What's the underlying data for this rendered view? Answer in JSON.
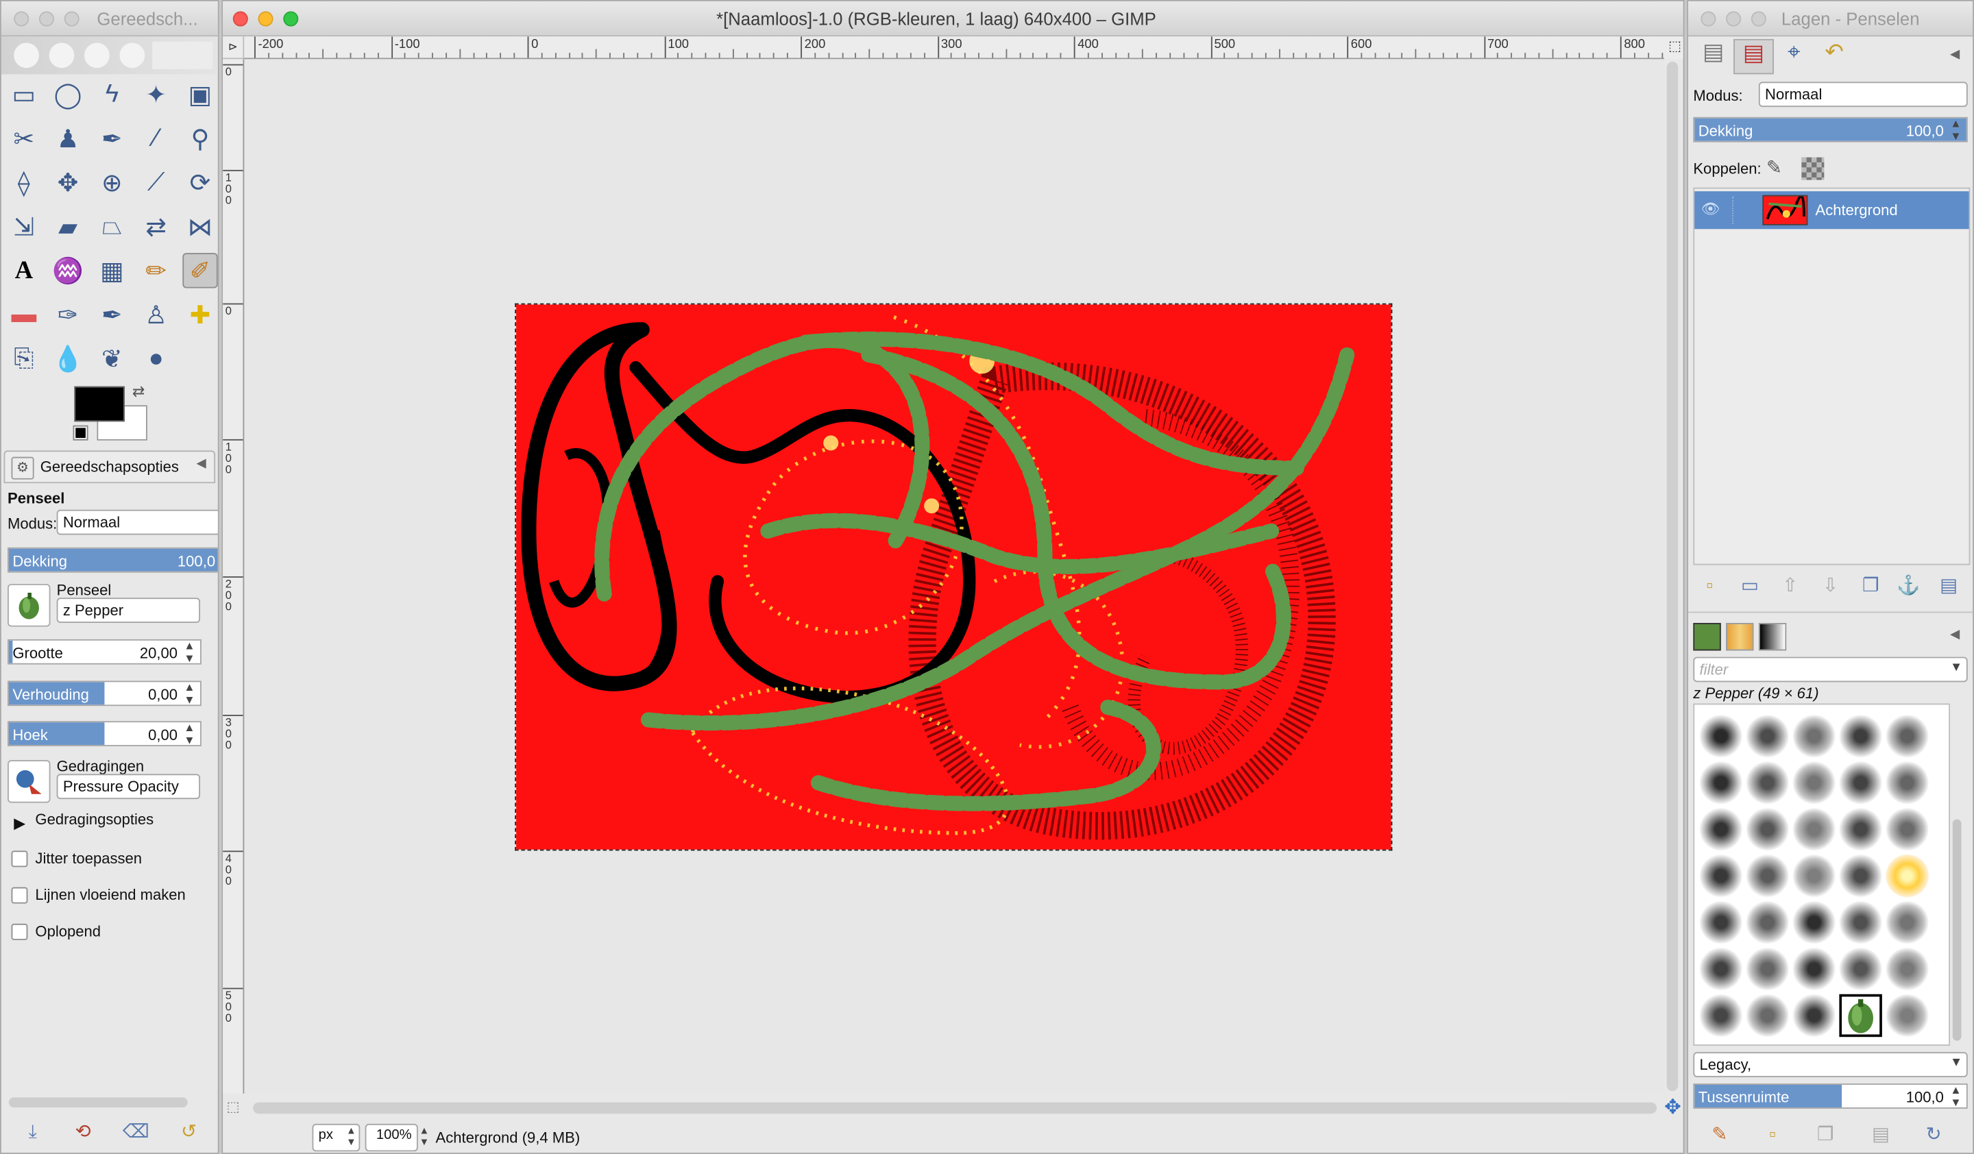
{
  "toolbox": {
    "title": "Gereedsch...",
    "tools_row1": [
      "rect-select",
      "ellipse-select",
      "free-select",
      "fuzzy-select",
      "color-select"
    ],
    "options_tab": "Gereedschapsopties",
    "tool_name": "Penseel",
    "mode_label": "Modus:",
    "mode_value": "Normaal",
    "opacity_label": "Dekking",
    "opacity_value": "100,0",
    "opacity_fraction": 1.0,
    "brush_label": "Penseel",
    "brush_value": "z Pepper",
    "size_label": "Grootte",
    "size_value": "20,00",
    "size_fraction": 0.02,
    "ratio_label": "Verhouding",
    "ratio_value": "0,00",
    "ratio_fraction": 0.5,
    "angle_label": "Hoek",
    "angle_value": "0,00",
    "angle_fraction": 0.5,
    "dynamics_label": "Gedragingen",
    "dynamics_value": "Pressure Opacity",
    "dynamics_options": "Gedragingsopties",
    "jitter_label": "Jitter toepassen",
    "smooth_label": "Lijnen vloeiend maken",
    "incremental_label": "Oplopend"
  },
  "image_window": {
    "title": "*[Naamloos]-1.0 (RGB-kleuren, 1 laag) 640x400 – GIMP",
    "ruler_top": [
      "-200",
      "-100",
      "0",
      "100",
      "200",
      "300",
      "400",
      "500",
      "600",
      "700",
      "800"
    ],
    "ruler_left": [
      "0",
      "100",
      "0",
      "100",
      "200",
      "300",
      "400",
      "500"
    ],
    "unit": "px",
    "zoom": "100%",
    "status": "Achtergrond (9,4 MB)",
    "canvas_color": "#ff1010"
  },
  "layers": {
    "title": "Lagen - Penselen",
    "mode_label": "Modus:",
    "mode_value": "Normaal",
    "opacity_label": "Dekking",
    "opacity_value": "100,0",
    "opacity_fraction": 1.0,
    "lock_label": "Koppelen:",
    "layer_name": "Achtergrond"
  },
  "brushes": {
    "filter_placeholder": "filter",
    "selected": "z Pepper (49 × 61)",
    "tag_value": "Legacy,",
    "spacing_label": "Tussenruimte",
    "spacing_value": "100,0",
    "spacing_fraction": 0.54
  },
  "colors": {
    "accent": "#6a95cb",
    "selected_row": "#5e8dc9",
    "foreground": "#000000",
    "background": "#ffffff"
  }
}
